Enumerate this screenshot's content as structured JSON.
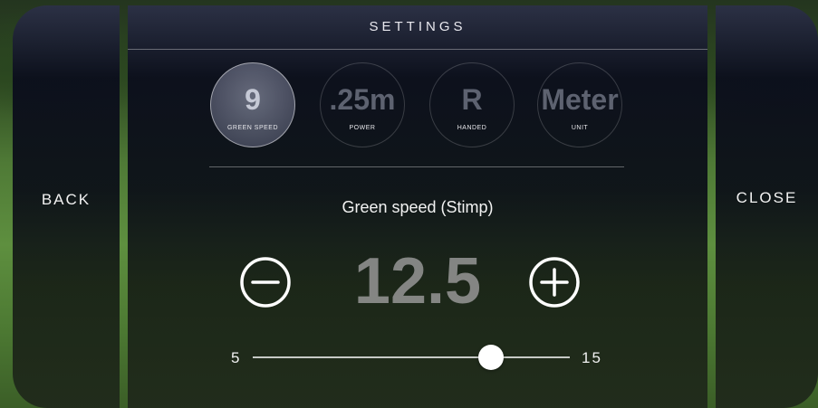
{
  "nav": {
    "back_label": "BACK",
    "close_label": "CLOSE"
  },
  "header": {
    "title": "SETTINGS"
  },
  "tiles": [
    {
      "value": "9",
      "label": "GREEN SPEED",
      "active": true
    },
    {
      "value": ".25m",
      "label": "POWER",
      "active": false
    },
    {
      "value": "R",
      "label": "HANDED",
      "active": false
    },
    {
      "value": "Meter",
      "label": "UNIT",
      "active": false
    }
  ],
  "setting": {
    "title": "Green speed (Stimp)",
    "value": "12.5",
    "min_label": "5",
    "max_label": "15",
    "min": 5,
    "max": 15,
    "current": 12.5,
    "minus_icon": "minus-circle-icon",
    "plus_icon": "plus-circle-icon"
  },
  "colors": {
    "text": "#f2f2f2",
    "value_gray": "#969696"
  }
}
